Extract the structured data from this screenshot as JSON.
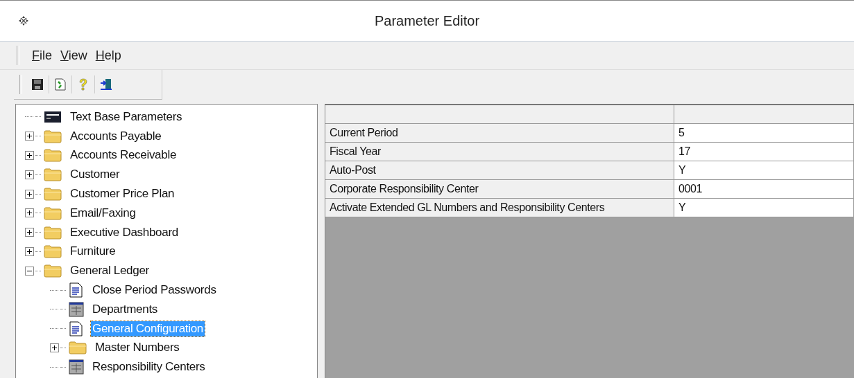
{
  "window": {
    "title": "Parameter Editor"
  },
  "menu": [
    "File",
    "View",
    "Help"
  ],
  "tree": [
    {
      "label": "Text Base Parameters",
      "kind": "textbase",
      "selected": false
    },
    {
      "label": "Accounts Payable",
      "kind": "folder",
      "expanded": false,
      "selected": false
    },
    {
      "label": "Accounts Receivable",
      "kind": "folder",
      "expanded": false,
      "selected": false
    },
    {
      "label": "Customer",
      "kind": "folder",
      "expanded": false,
      "selected": false
    },
    {
      "label": "Customer Price Plan",
      "kind": "folder",
      "expanded": false,
      "selected": false
    },
    {
      "label": "Email/Faxing",
      "kind": "folder",
      "expanded": false,
      "selected": false
    },
    {
      "label": "Executive Dashboard",
      "kind": "folder",
      "expanded": false,
      "selected": false
    },
    {
      "label": "Furniture",
      "kind": "folder",
      "expanded": false,
      "selected": false
    },
    {
      "label": "General Ledger",
      "kind": "folder",
      "expanded": true,
      "selected": false,
      "children": [
        {
          "label": "Close Period Passwords",
          "kind": "document",
          "selected": false
        },
        {
          "label": "Departments",
          "kind": "table",
          "selected": false
        },
        {
          "label": "General Configuration",
          "kind": "document",
          "selected": true
        },
        {
          "label": "Master Numbers",
          "kind": "folder",
          "expanded": false,
          "selected": false
        },
        {
          "label": "Responsibility Centers",
          "kind": "table",
          "selected": false
        }
      ]
    }
  ],
  "grid": {
    "rows": [
      {
        "name": "Current Period",
        "value": " 5"
      },
      {
        "name": "Fiscal Year",
        "value": "17"
      },
      {
        "name": "Auto-Post",
        "value": "Y"
      },
      {
        "name": "Corporate Responsibility Center",
        "value": "0001"
      },
      {
        "name": "Activate Extended GL Numbers and Responsibility Centers",
        "value": "Y"
      }
    ]
  }
}
